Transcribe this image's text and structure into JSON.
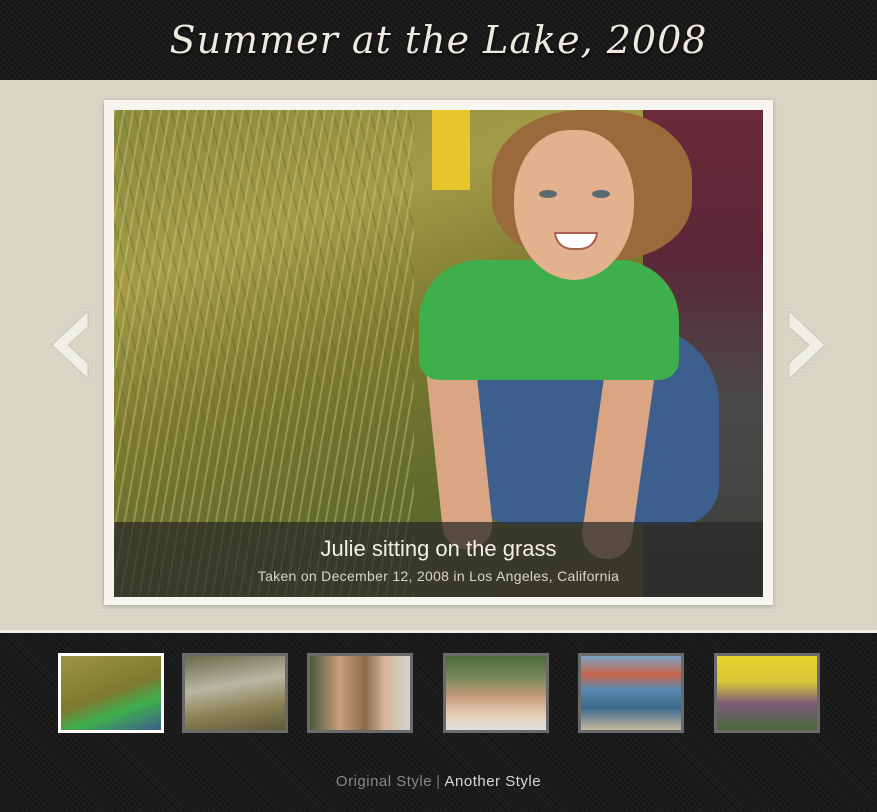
{
  "header": {
    "title": "Summer at the Lake, 2008"
  },
  "slide": {
    "caption_title": "Julie sitting on the grass",
    "caption_subtitle": "Taken on December 12, 2008 in Los Angeles, California"
  },
  "nav": {
    "prev_icon": "chevron-left-icon",
    "next_icon": "chevron-right-icon"
  },
  "thumbnails": [
    {
      "label": "girl in grass",
      "active": true
    },
    {
      "label": "shoes in grass",
      "active": false
    },
    {
      "label": "two women portrait",
      "active": false
    },
    {
      "label": "smiling friends",
      "active": false
    },
    {
      "label": "canoe carry",
      "active": false
    },
    {
      "label": "tent group",
      "active": false
    }
  ],
  "footer": {
    "link_original": "Original Style",
    "separator": "|",
    "link_another": "Another Style"
  },
  "colors": {
    "stage_bg": "#d6d5c4",
    "dark_bg": "#1c1c1c",
    "thumb_border": "#6a6a6a",
    "thumb_active_border": "#ffffff"
  }
}
